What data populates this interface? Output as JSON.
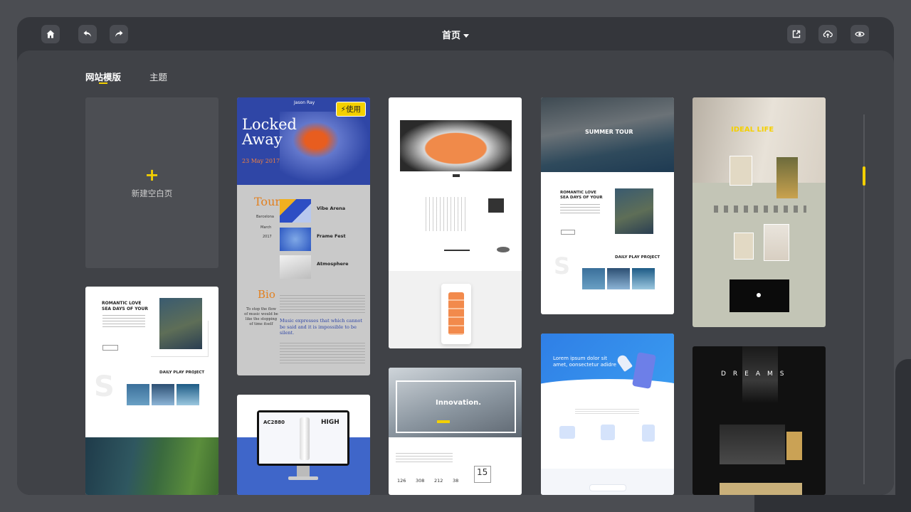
{
  "topbar": {
    "page_title": "首页",
    "icons": [
      "home-icon",
      "undo-icon",
      "redo-icon",
      "export-icon",
      "cloud-upload-icon",
      "preview-eye-icon"
    ]
  },
  "tabs": [
    {
      "label": "网站模版",
      "active": true
    },
    {
      "label": "主题",
      "active": false
    }
  ],
  "new_page": {
    "plus": "+",
    "label": "新建空白页"
  },
  "use_badge": "使用",
  "templates": {
    "locked_away": {
      "brand": "Jason Ray",
      "title_line1": "Locked",
      "title_line2": "Away",
      "date": "23 May 2017",
      "tour": "Tour",
      "tour_city": "Barcelona",
      "tour_month": "March",
      "tour_year": "2017",
      "events": [
        "Vibe Arena",
        "Frame Fest",
        "Atmosphere"
      ],
      "bio": "Bio",
      "bio_quote": "To stop the flow of music would be like the stopping of time itself",
      "music_quote": "Music expresses that which cannot be said and it is impossible to be silent."
    },
    "summer_tour": {
      "hero": "SUMMER TOUR",
      "headline": "ROMANTIC LOVE SEA DAYS OF YOUR",
      "daily": "DAILY PLAY PROJECT"
    },
    "romantic_left": {
      "headline": "ROMANTIC LOVE SEA DAYS OF YOUR",
      "daily": "DAILY PLAY PROJECT"
    },
    "ideal_life": {
      "title": "IDEAL LIFE"
    },
    "innovation": {
      "title": "Innovation.",
      "stats": [
        "126",
        "308",
        "212",
        "38"
      ],
      "number": "15"
    },
    "lorem": {
      "headline_line1": "Lorem ipsum dolor sit",
      "headline_line2": "amet, oonsectetur adidre"
    },
    "ac2880": {
      "model": "AC2880",
      "headline": "HIGH"
    },
    "dreams": {
      "title": "DREAMS"
    }
  },
  "colors": {
    "accent": "#f4d000",
    "window": "#34363b",
    "panel": "#404247",
    "blue": "#2f46a6"
  }
}
